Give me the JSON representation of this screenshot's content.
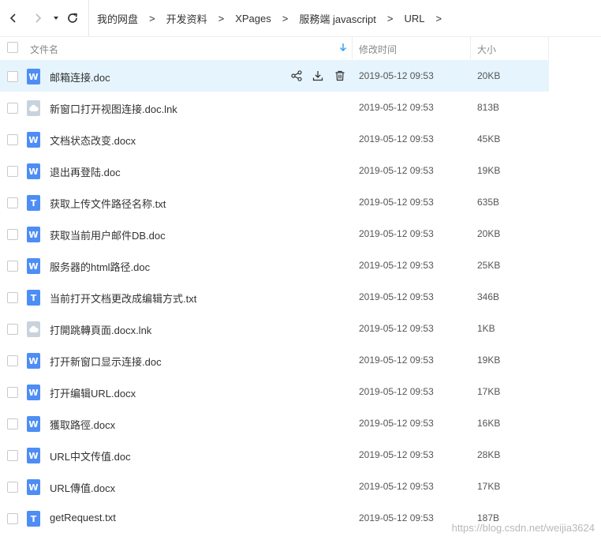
{
  "toolbar": {
    "back_icon": "chevron-left-icon",
    "forward_icon": "chevron-right-icon",
    "dropdown_icon": "caret-down-icon",
    "refresh_icon": "refresh-icon"
  },
  "breadcrumb": [
    "我的网盘",
    "开发资料",
    "XPages",
    "服務端 javascript",
    "URL"
  ],
  "breadcrumb_separator": ">",
  "columns": {
    "name": "文件名",
    "modified": "修改时间",
    "size": "大小",
    "sort_icon": "arrow-down-icon"
  },
  "colors": {
    "highlight": "#e6f4fd",
    "accent": "#4d8df5",
    "sort_arrow": "#2d9cf0"
  },
  "row_actions": [
    "share-icon",
    "download-icon",
    "delete-icon"
  ],
  "files": [
    {
      "name": "邮箱连接.doc",
      "time": "2019-05-12 09:53",
      "size": "20KB",
      "type": "doc"
    },
    {
      "name": "新窗口打开视图连接.doc.lnk",
      "time": "2019-05-12 09:53",
      "size": "813B",
      "type": "lnk"
    },
    {
      "name": "文档状态改变.docx",
      "time": "2019-05-12 09:53",
      "size": "45KB",
      "type": "doc"
    },
    {
      "name": "退出再登陆.doc",
      "time": "2019-05-12 09:53",
      "size": "19KB",
      "type": "doc"
    },
    {
      "name": "获取上传文件路径名称.txt",
      "time": "2019-05-12 09:53",
      "size": "635B",
      "type": "txt"
    },
    {
      "name": "获取当前用户邮件DB.doc",
      "time": "2019-05-12 09:53",
      "size": "20KB",
      "type": "doc"
    },
    {
      "name": "服务器的html路径.doc",
      "time": "2019-05-12 09:53",
      "size": "25KB",
      "type": "doc"
    },
    {
      "name": "当前打开文档更改成编辑方式.txt",
      "time": "2019-05-12 09:53",
      "size": "346B",
      "type": "txt"
    },
    {
      "name": "打開跳轉頁面.docx.lnk",
      "time": "2019-05-12 09:53",
      "size": "1KB",
      "type": "lnk"
    },
    {
      "name": "打开新窗口显示连接.doc",
      "time": "2019-05-12 09:53",
      "size": "19KB",
      "type": "doc"
    },
    {
      "name": "打开编辑URL.docx",
      "time": "2019-05-12 09:53",
      "size": "17KB",
      "type": "doc"
    },
    {
      "name": "獲取路徑.docx",
      "time": "2019-05-12 09:53",
      "size": "16KB",
      "type": "doc"
    },
    {
      "name": "URL中文传值.doc",
      "time": "2019-05-12 09:53",
      "size": "28KB",
      "type": "doc"
    },
    {
      "name": "URL傳值.docx",
      "time": "2019-05-12 09:53",
      "size": "17KB",
      "type": "doc"
    },
    {
      "name": "getRequest.txt",
      "time": "2019-05-12 09:53",
      "size": "187B",
      "type": "txt"
    }
  ],
  "icon_glyphs": {
    "doc": "W",
    "txt": "T"
  },
  "watermark": "https://blog.csdn.net/weijia3624"
}
